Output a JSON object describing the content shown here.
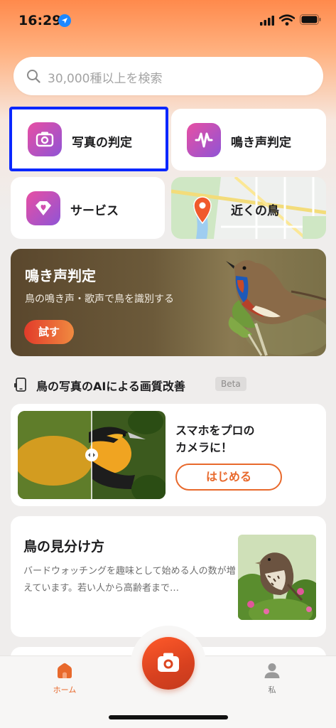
{
  "status_bar": {
    "time": "16:29"
  },
  "search": {
    "placeholder": "30,000種以上を検索"
  },
  "tiles": [
    {
      "label": "写真の判定",
      "icon": "camera-icon"
    },
    {
      "label": "鳴き声判定",
      "icon": "soundwave-icon"
    },
    {
      "label": "サービス",
      "icon": "heart-diamond-icon"
    },
    {
      "label": "近くの鳥",
      "icon": "map-pin-icon"
    }
  ],
  "banner": {
    "title": "鳴き声判定",
    "subtitle": "鳥の鳴き声・歌声で鳥を識別する",
    "button": "試す"
  },
  "ai_section": {
    "title": "鳥の写真のAIによる画質改善",
    "badge": "Beta",
    "card_text_line1": "スマホをプロの",
    "card_text_line2": "カメラに！",
    "button": "はじめる"
  },
  "guide": {
    "title": "鳥の見分け方",
    "body": "バードウォッチングを趣味として始める人の数が増えています。若い人から高齢者まで…"
  },
  "tabbar": {
    "home_label": "ホーム",
    "me_label": "私"
  },
  "colors": {
    "accent": "#e8692c",
    "tile_icon_gradient": [
      "#e84fa3",
      "#8f54d6"
    ],
    "selection_border": "#0a27ff"
  }
}
